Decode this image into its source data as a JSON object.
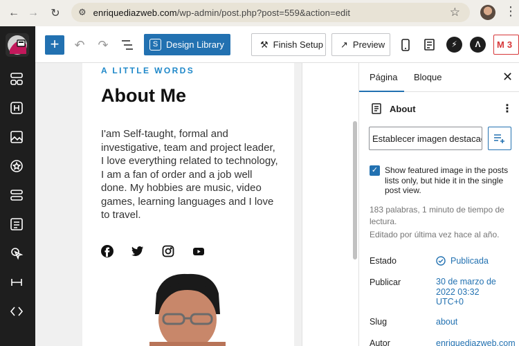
{
  "browser": {
    "url_domain": "enriquediazweb.com",
    "url_path": "/wp-admin/post.php?post=559&action=edit"
  },
  "toolbar": {
    "design_library_label": "Design Library",
    "finish_setup_label": "Finish Setup",
    "preview_label": "Preview",
    "jetpack_count": "3"
  },
  "content": {
    "kicker": "A LITTLE WORDS",
    "title": "About Me",
    "body": "I'am Self-taught, formal and investigative, team and project leader, I love everything related to technology, I am a fan of order and a job well done. My hobbies are music, video games, learning languages and I love to travel."
  },
  "panel": {
    "tab_page": "Página",
    "tab_block": "Bloque",
    "page_name": "About",
    "featured_image_label": "Establecer imagen destacada",
    "featured_checkbox_label": "Show featured image in the posts lists only, but hide it in the single post view.",
    "featured_checked": true,
    "word_count_text": "183 palabras, 1 minuto de tiempo de lectura.",
    "last_edited_text": "Editado por última vez hace al año.",
    "status_label": "Estado",
    "status_value": "Publicada",
    "publish_label": "Publicar",
    "publish_value": "30 de marzo de 2022 03:32 UTC+0",
    "slug_label": "Slug",
    "slug_value": "about",
    "author_label": "Autor",
    "author_value": "enriquediazweb.com"
  },
  "colors": {
    "accent": "#2271b1",
    "kicker": "#1e88c9",
    "sidebar_bg": "#1e1e1e"
  }
}
